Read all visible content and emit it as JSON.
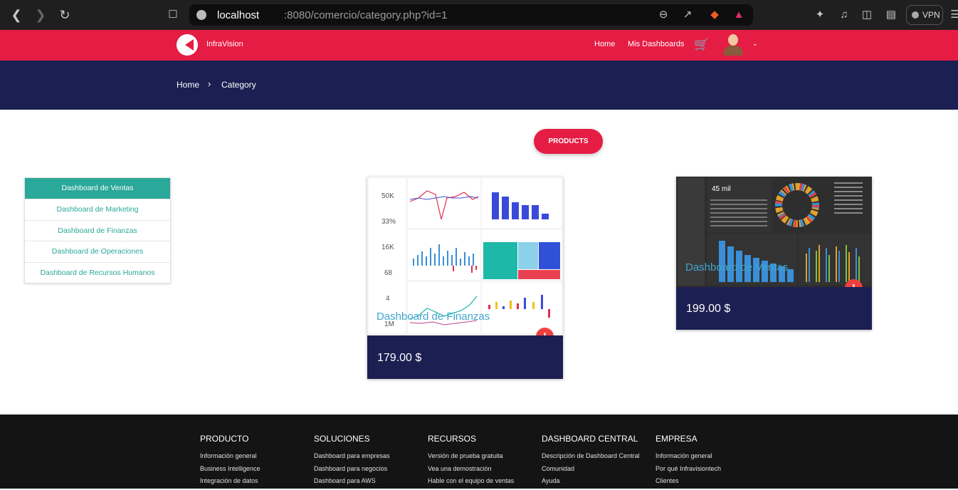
{
  "browser": {
    "url_host": "localhost",
    "url_rest": ":8080/comercio/category.php?id=1",
    "vpn_label": "VPN"
  },
  "header": {
    "brand": "InfraVision",
    "nav": [
      "Home",
      "Mis Dashboards"
    ],
    "accent": "#e51c44"
  },
  "hero": {
    "breadcrumb": [
      "Home",
      "Category"
    ],
    "bg": "#1c1f52"
  },
  "products_button": "PRODUCTS",
  "sidebar": {
    "items": [
      {
        "label": "Dashboard de Ventas",
        "active": true
      },
      {
        "label": "Dashboard de Marketing",
        "active": false
      },
      {
        "label": "Dashboard de Finanzas",
        "active": false
      },
      {
        "label": "Dashboard de Operaciones",
        "active": false
      },
      {
        "label": "Dashboard de Recursos Humanos",
        "active": false
      }
    ]
  },
  "products": [
    {
      "title": "Dashboard de Finanzas",
      "price": "179.00 $",
      "kpis": [
        "50K",
        "33%",
        "16K",
        "68",
        "4",
        "1M"
      ]
    },
    {
      "title": "Dashboard de Ventas",
      "price": "199.00 $",
      "kpis": [
        "45 mil"
      ]
    }
  ],
  "footer": {
    "columns": [
      {
        "title": "PRODUCTO",
        "links": [
          "Información general",
          "Business Intelligence",
          "Integración de datos"
        ]
      },
      {
        "title": "SOLUCIONES",
        "links": [
          "Dashboard para empresas",
          "Dashboard para negocios",
          "Dashboard para AWS"
        ]
      },
      {
        "title": "RECURSOS",
        "links": [
          "Versión de prueba gratuita",
          "Vea una demostración",
          "Hable con el equipo de ventas"
        ]
      },
      {
        "title": "DASHBOARD CENTRAL",
        "links": [
          "Descripción de Dashboard Central",
          "Comunidad",
          "Ayuda"
        ]
      },
      {
        "title": "EMPRESA",
        "links": [
          "Información general",
          "Por qué Infravisiontech",
          "Clientes"
        ]
      }
    ]
  }
}
